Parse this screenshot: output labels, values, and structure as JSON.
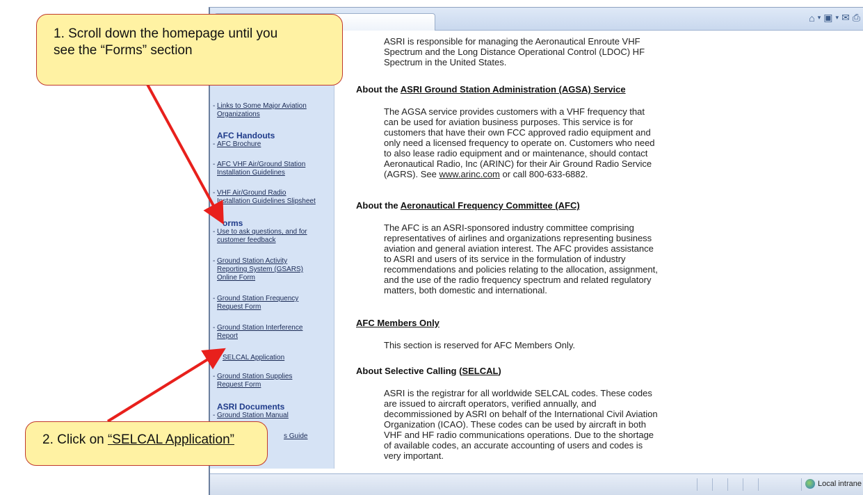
{
  "callouts": {
    "step1_line1": "1. Scroll down the homepage until you",
    "step1_line2": "see the “Forms” section",
    "step2_prefix": "2. Click on ",
    "step2_link": "“SELCAL Application”"
  },
  "statusbar": {
    "zone": "Local intrane"
  },
  "sidebar": {
    "links_line1": "Links to Some Major Aviation",
    "links_line2": "Organizations",
    "afc_handouts": "AFC Handouts",
    "afc_brochure": "AFC Brochure",
    "afc_vhf_1": "AFC VHF Air/Ground Station",
    "afc_vhf_2": "Installation Guidelines",
    "vhf_radio_1": "VHF Air/Ground Radio",
    "vhf_radio_2": "Installation Guidelines Slipsheet",
    "forms": "orms",
    "forms_q1": "Use to ask questions, and for",
    "forms_q2": "customer feedback",
    "gsars_1": "Ground Station Activity",
    "gsars_2": "Reporting System (GSARS)",
    "gsars_3": "Online Form",
    "freq_1": "Ground Station Frequency",
    "freq_2": "Request Form",
    "interf_1": "Ground Station Interference",
    "interf_2": "Report",
    "selcal": "SELCAL Application",
    "supplies_1": "Ground Station Supplies",
    "supplies_2": "Request Form",
    "asri_docs": "ASRI Documents",
    "manual": "Ground Station Manual",
    "guide_partial": "s Guide"
  },
  "content": {
    "intro": [
      "ASRI is responsible for managing the Aeronautical Enroute VHF",
      "Spectrum and the Long Distance Operational Control (LDOC) HF",
      "Spectrum in the United States."
    ],
    "agsa_prefix": "About the ",
    "agsa_link": "ASRI Ground Station Administration (AGSA) Service",
    "agsa_body": [
      "The AGSA service provides customers with a VHF frequency that",
      "can be used for aviation business purposes. This service is for",
      "customers that have their own FCC approved radio equipment and",
      "only need a licensed frequency to operate on. Customers who need",
      "to also lease radio equipment and or maintenance, should contact",
      "Aeronautical Radio, Inc (ARINC) for their Air Ground Radio Service"
    ],
    "agsa_last_pre": "(AGRS). See ",
    "agsa_last_link": "www.arinc.com",
    "agsa_last_post": " or call 800-633-6882.",
    "afc_prefix": "About the ",
    "afc_link": "Aeronautical Frequency Committee (AFC)",
    "afc_body": [
      "The AFC is an ASRI-sponsored industry committee comprising",
      "representatives of airlines and organizations representing business",
      "aviation and general aviation interest. The AFC provides assistance",
      "to ASRI and users of its service in the formulation of industry",
      "recommendations and policies relating to the allocation, assignment,",
      "and the use of the radio frequency spectrum and related regulatory",
      "matters, both domestic and international."
    ],
    "members_link": "AFC Members Only",
    "members_body": "This section is reserved for AFC Members Only.",
    "selcal_prefix": "About Selective Calling (",
    "selcal_link": "SELCAL",
    "selcal_suffix": ")",
    "selcal_body": [
      "ASRI is the registrar for all worldwide SELCAL codes. These codes",
      "are issued to aircraft operators, verified annually, and",
      "decommissioned by ASRI on behalf of the International Civil Aviation",
      "Organization (ICAO). These codes can be used by aircraft in both",
      "VHF and HF radio communications operations. Due to the shortage",
      "of available codes, an accurate accounting of users and codes is",
      "very important."
    ]
  },
  "colors": {
    "arrow": "#e8201c",
    "callout_fill": "#fff2a3",
    "sidebar_bg": "#d6e3f5"
  }
}
